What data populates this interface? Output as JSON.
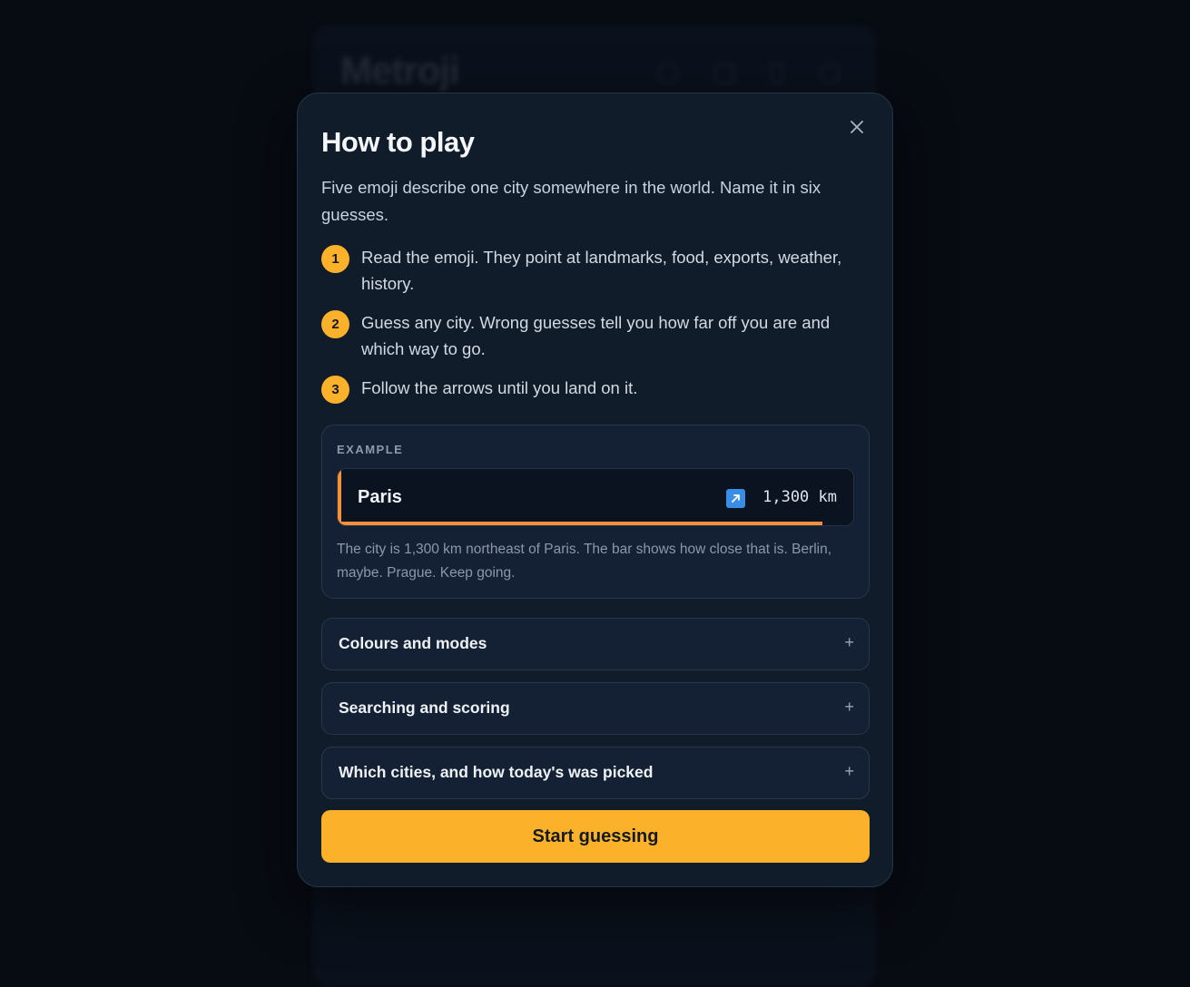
{
  "background_app": {
    "logo": "Metroji",
    "footer_links": [
      "",
      "",
      ""
    ],
    "footer_bar": [
      "",
      ""
    ]
  },
  "modal": {
    "title": "How to play",
    "intro": "Five emoji describe one city somewhere in the world. Name it in six guesses.",
    "close_icon": "close-icon",
    "steps": [
      {
        "number": "1",
        "text": "Read the emoji. They point at landmarks, food, exports, weather, history."
      },
      {
        "number": "2",
        "text": "Guess any city. Wrong guesses tell you how far off you are and which way to go."
      },
      {
        "number": "3",
        "text": "Follow the arrows until you land on it."
      }
    ],
    "example": {
      "label": "EXAMPLE",
      "guess": {
        "city": "Paris",
        "direction_icon": "arrow-northeast-icon",
        "distance": "1,300 km",
        "proximity_fraction": 0.94
      },
      "description": "The city is 1,300 km northeast of Paris. The bar shows how close that is. Berlin, maybe. Prague. Keep going."
    },
    "accordions": [
      {
        "title": "Colours and modes",
        "icon": "+"
      },
      {
        "title": "Searching and scoring",
        "icon": "+"
      },
      {
        "title": "Which cities, and how today's was picked",
        "icon": "+"
      }
    ],
    "start_button": "Start guessing"
  },
  "colors": {
    "accent": "#fbb12a",
    "guess_accent": "#f4913a",
    "arrow_bg": "#3a8de6",
    "modal_bg": "#111c2b",
    "page_bg": "#070b12"
  }
}
